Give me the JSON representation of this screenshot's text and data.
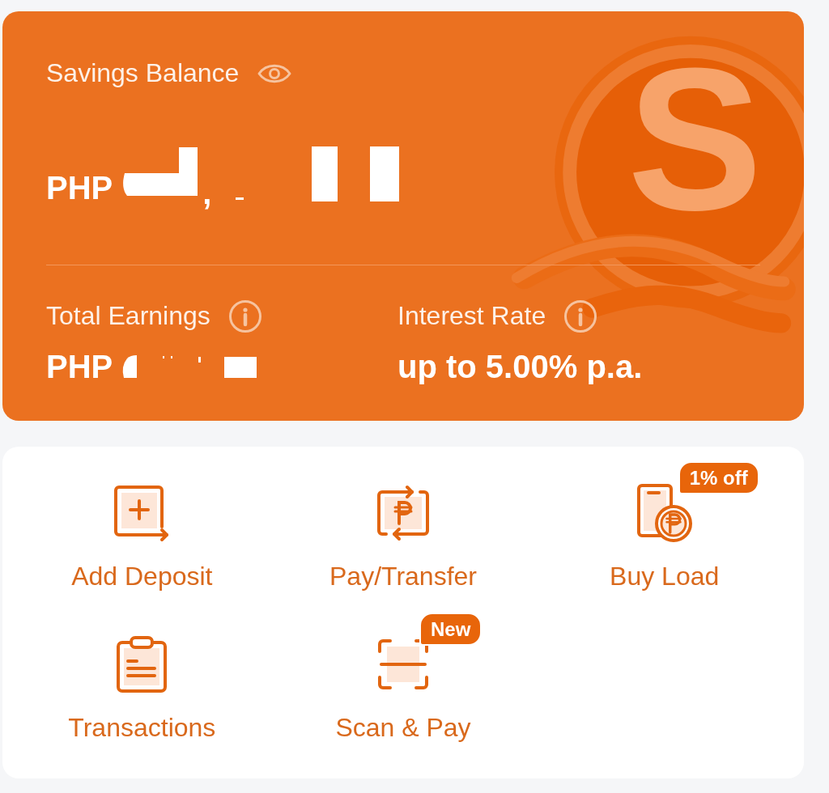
{
  "card": {
    "title": "Savings Balance",
    "logo_letter": "S",
    "balance": {
      "currency": "PHP",
      "visible_fragment": ","
    },
    "stats": [
      {
        "kind": "redacted",
        "label": "Total Earnings",
        "currency": "PHP"
      },
      {
        "kind": "text",
        "label": "Interest Rate",
        "value": "up to 5.00% p.a."
      }
    ]
  },
  "actions": [
    {
      "kind": "deposit",
      "label": "Add Deposit"
    },
    {
      "kind": "transfer",
      "label": "Pay/Transfer"
    },
    {
      "kind": "load",
      "label": "Buy Load",
      "badge": "1% off"
    },
    {
      "kind": "history",
      "label": "Transactions"
    },
    {
      "kind": "scan",
      "label": "Scan & Pay",
      "badge": "New"
    }
  ]
}
